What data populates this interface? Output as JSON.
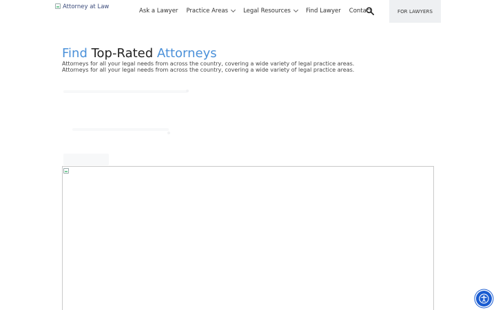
{
  "header": {
    "logo_alt": "Attorney at Law",
    "nav": [
      {
        "label": "Ask a Lawyer",
        "has_dropdown": false
      },
      {
        "label": "Practice Areas",
        "has_dropdown": true
      },
      {
        "label": "Legal Resources",
        "has_dropdown": true
      },
      {
        "label": "Find Lawyer",
        "has_dropdown": false
      },
      {
        "label": "Contact",
        "has_dropdown": false
      }
    ],
    "search_icon": "search-icon",
    "cta_label": "FOR LAWYERS"
  },
  "hero": {
    "title_part1": "Find",
    "title_part2": " Top-Rated ",
    "title_part3": "Attorneys",
    "subtitle_1": "Attorneys for all your legal needs from across the country, covering a wide variety of legal practice areas.",
    "subtitle_2": "Attorneys for all your legal needs from across the country, covering a wide variety of legal practice areas."
  },
  "colors": {
    "accent_blue": "#4a90d9",
    "accessibility_blue": "#1a5cd1",
    "cta_background": "#eef0f2"
  },
  "accessibility_icon": "accessibility-icon"
}
